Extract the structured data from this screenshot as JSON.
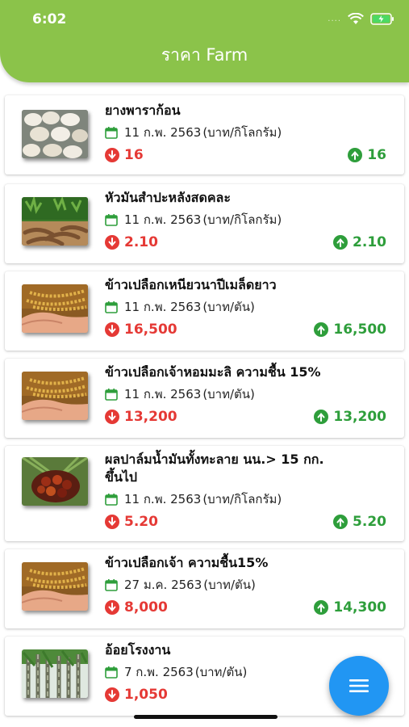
{
  "status_bar": {
    "time": "6:02",
    "dots": "...."
  },
  "app_bar": {
    "title": "ราคา Farm"
  },
  "colors": {
    "primary": "#8bc34a",
    "down": "#e53935",
    "up": "#2e9e3b",
    "fab": "#2196f3"
  },
  "items": [
    {
      "name": "ยางพาราก้อน",
      "date": "11 ก.พ. 2563",
      "unit": "(บาท/กิโลกรัม)",
      "low": "16",
      "high": "16",
      "image_icon": "rubber-lumps-photo"
    },
    {
      "name": "หัวมันสำปะหลังสดคละ",
      "date": "11 ก.พ. 2563",
      "unit": "(บาท/กิโลกรัม)",
      "low": "2.10",
      "high": "2.10",
      "image_icon": "cassava-photo"
    },
    {
      "name": "ข้าวเปลือกเหนียวนาปีเมล็ดยาว",
      "date": "11 ก.พ. 2563",
      "unit": "(บาท/ตัน)",
      "low": "16,500",
      "high": "16,500",
      "image_icon": "rice-grain-photo"
    },
    {
      "name": "ข้าวเปลือกเจ้าหอมมะลิ ความชื้น 15%",
      "date": "11 ก.พ. 2563",
      "unit": "(บาท/ตัน)",
      "low": "13,200",
      "high": "13,200",
      "image_icon": "rice-grain-photo"
    },
    {
      "name": "ผลปาล์มน้ำมันทั้งทะลาย นน.> 15 กก.",
      "name_line2": "ขึ้นไป",
      "date": "11 ก.พ. 2563",
      "unit": "(บาท/กิโลกรัม)",
      "low": "5.20",
      "high": "5.20",
      "image_icon": "oil-palm-photo"
    },
    {
      "name": "ข้าวเปลือกเจ้า ความชื้น15%",
      "date": "27 ม.ค. 2563",
      "unit": "(บาท/ตัน)",
      "low": "8,000",
      "high": "14,300",
      "image_icon": "rice-grain-photo"
    },
    {
      "name": "อ้อยโรงงาน",
      "date": "7 ก.พ. 2563",
      "unit": "(บาท/ตัน)",
      "low": "1,050",
      "high": "",
      "image_icon": "sugarcane-photo"
    }
  ],
  "fab": {
    "icon": "menu-icon"
  }
}
